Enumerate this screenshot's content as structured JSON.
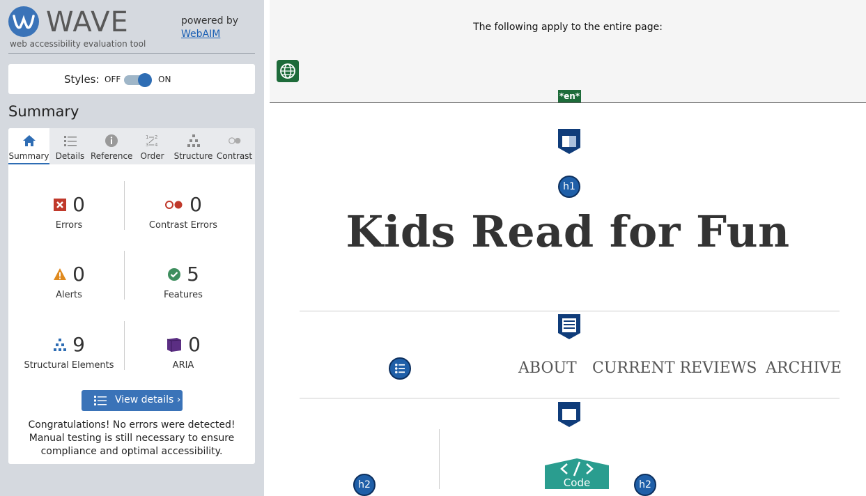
{
  "sidebar": {
    "brand": {
      "title": "WAVE",
      "subtitle": "web accessibility evaluation tool",
      "powered_by": "powered by",
      "webaim_link": "WebAIM"
    },
    "styles_toggle": {
      "label": "Styles:",
      "off_label": "OFF",
      "on_label": "ON",
      "state": "on"
    },
    "summary_heading": "Summary",
    "tabs": [
      {
        "label": "Summary",
        "icon": "home-icon",
        "active": true
      },
      {
        "label": "Details",
        "icon": "list-icon",
        "active": false
      },
      {
        "label": "Reference",
        "icon": "info-icon",
        "active": false
      },
      {
        "label": "Order",
        "icon": "order-icon",
        "active": false
      },
      {
        "label": "Structure",
        "icon": "structure-icon",
        "active": false
      },
      {
        "label": "Contrast",
        "icon": "contrast-icon",
        "active": false
      }
    ],
    "stats": {
      "errors": {
        "count": "0",
        "label": "Errors",
        "color": "#c0392b"
      },
      "contrast_errors": {
        "count": "0",
        "label": "Contrast Errors",
        "color": "#c0392b"
      },
      "alerts": {
        "count": "0",
        "label": "Alerts",
        "color": "#e08a1e"
      },
      "features": {
        "count": "5",
        "label": "Features",
        "color": "#3e8e5e"
      },
      "structural": {
        "count": "9",
        "label": "Structural Elements",
        "color": "#2e6db4"
      },
      "aria": {
        "count": "0",
        "label": "ARIA",
        "color": "#5b2e83"
      }
    },
    "view_details_label": "View details ›",
    "congrats": "Congratulations! No errors were detected! Manual testing is still necessary to ensure compliance and optimal accessibility."
  },
  "page": {
    "page_level_text": "The following apply to the entire page:",
    "lang_badge": "*en*",
    "title": "Kids Read for Fun",
    "h1_badge": "h1",
    "nav_links": [
      "ABOUT",
      "CURRENT REVIEWS",
      "ARCHIVE"
    ],
    "h2_badge_left": "h2",
    "h2_badge_right": "h2",
    "code_label": "Code"
  },
  "colors": {
    "accent": "#2e6db4",
    "sidebar_bg": "#d5d9df",
    "lang_green": "#1e6b3a",
    "code_teal": "#2a9d8f",
    "structure_navy": "#0f3c7a"
  }
}
